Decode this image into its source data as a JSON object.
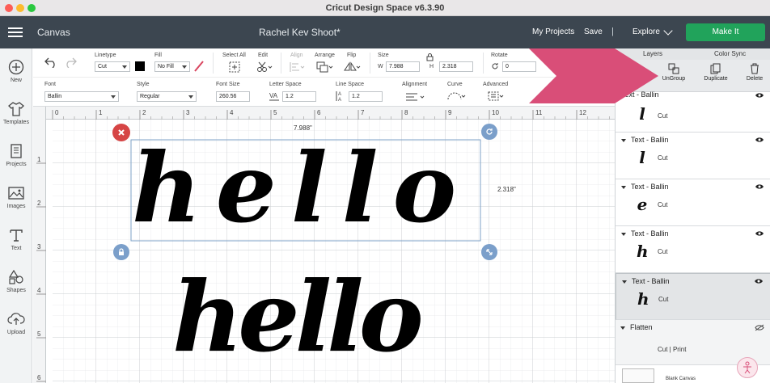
{
  "window": {
    "title": "Cricut Design Space  v6.3.90"
  },
  "header": {
    "section": "Canvas",
    "project_name": "Rachel Kev Shoot*",
    "my_projects": "My Projects",
    "save": "Save",
    "separator": "|",
    "explore": "Explore",
    "make_it": "Make It"
  },
  "sidebar": {
    "items": [
      {
        "label": "New",
        "icon": "plus-circle-icon"
      },
      {
        "label": "Templates",
        "icon": "shirt-icon"
      },
      {
        "label": "Projects",
        "icon": "book-icon"
      },
      {
        "label": "Images",
        "icon": "image-icon"
      },
      {
        "label": "Text",
        "icon": "text-t-icon"
      },
      {
        "label": "Shapes",
        "icon": "shapes-icon"
      },
      {
        "label": "Upload",
        "icon": "cloud-upload-icon"
      }
    ]
  },
  "toolbar": {
    "linetype_label": "Linetype",
    "linetype_value": "Cut",
    "fill_label": "Fill",
    "fill_value": "No Fill",
    "select_all_label": "Select All",
    "edit_label": "Edit",
    "align_label": "Align",
    "arrange_label": "Arrange",
    "flip_label": "Flip",
    "size_label": "Size",
    "w_label": "W",
    "w_value": "7.988",
    "h_label": "H",
    "h_value": "2.318",
    "rotate_label": "Rotate",
    "rotate_value": "0",
    "font_label": "Font",
    "font_value": "Ballin",
    "style_label": "Style",
    "style_value": "Regular",
    "font_size_label": "Font Size",
    "font_size_value": "260.56",
    "letter_space_label": "Letter Space",
    "letter_space_value": "1.2",
    "line_space_label": "Line Space",
    "line_space_value": "1.2",
    "alignment_label": "Alignment",
    "curve_label": "Curve",
    "advanced_label": "Advanced",
    "accent_color": "#d94e78"
  },
  "canvas": {
    "ruler_numbers": [
      "0",
      "1",
      "2",
      "3",
      "4",
      "5",
      "6",
      "7",
      "8",
      "9",
      "10",
      "11",
      "12"
    ],
    "ruler_left_numbers": [
      "1",
      "2",
      "3",
      "4",
      "5",
      "6"
    ],
    "width_dim": "7.988\"",
    "height_dim": "2.318\"",
    "selected_text": "hello",
    "second_text": "hello"
  },
  "panel": {
    "tab_layers": "Layers",
    "tab_color_sync": "Color Sync",
    "ungroup": "UnGroup",
    "duplicate": "Duplicate",
    "delete": "Delete",
    "layers": [
      {
        "name": "Text - Ballin",
        "glyph": "l",
        "op": "Cut"
      },
      {
        "name": "Text - Ballin",
        "glyph": "l",
        "op": "Cut"
      },
      {
        "name": "Text - Ballin",
        "glyph": "e",
        "op": "Cut"
      },
      {
        "name": "Text - Ballin",
        "glyph": "h",
        "op": "Cut"
      },
      {
        "name": "Text - Ballin",
        "glyph": "h",
        "op": "Cut"
      }
    ],
    "flatten": "Flatten",
    "flatten_op": "Cut  |  Print",
    "blank_canvas": "Blank Canvas"
  }
}
